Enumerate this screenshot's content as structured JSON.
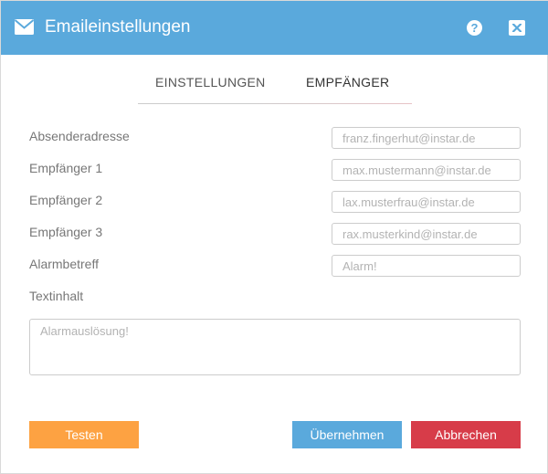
{
  "window": {
    "title": "Emaileinstellungen",
    "title_icon": "envelope-icon",
    "help_label": "?",
    "help_icon": "question-circle-icon",
    "close_icon": "close-x-icon"
  },
  "tabs": [
    {
      "label": "EINSTELLUNGEN",
      "active": false
    },
    {
      "label": "EMPFÄNGER",
      "active": true
    }
  ],
  "form": {
    "fields": [
      {
        "label": "Absenderadresse",
        "placeholder": "franz.fingerhut@instar.de",
        "value": ""
      },
      {
        "label": "Empfänger 1",
        "placeholder": "max.mustermann@instar.de",
        "value": ""
      },
      {
        "label": "Empfänger 2",
        "placeholder": "lax.musterfrau@instar.de",
        "value": ""
      },
      {
        "label": "Empfänger 3",
        "placeholder": "rax.musterkind@instar.de",
        "value": ""
      },
      {
        "label": "Alarmbetreff",
        "placeholder": "Alarm!",
        "value": ""
      }
    ],
    "body": {
      "label": "Textinhalt",
      "placeholder": "Alarmauslösung!",
      "value": ""
    }
  },
  "buttons": {
    "test": "Testen",
    "apply": "Übernehmen",
    "cancel": "Abbrechen"
  },
  "colors": {
    "titlebar": "#5aa9dc",
    "test_button": "#fda242",
    "apply_button": "#5aa9dc",
    "cancel_button": "#d73c49"
  }
}
